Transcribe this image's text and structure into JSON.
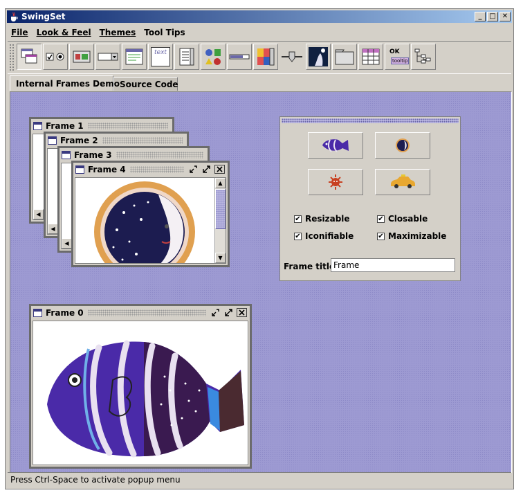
{
  "window": {
    "title": "SwingSet",
    "min_label": "_",
    "max_label": "□",
    "close_label": "✕"
  },
  "menu": [
    {
      "label": "File",
      "mnemonic": "F"
    },
    {
      "label": "Look & Feel",
      "mnemonic": "L"
    },
    {
      "label": "Themes",
      "mnemonic": "T"
    },
    {
      "label": "Tool Tips",
      "mnemonic": "o"
    }
  ],
  "toolbar": {
    "buttons": [
      {
        "name": "internal-frames-icon",
        "selected": true
      },
      {
        "name": "checkbox-radio-icon"
      },
      {
        "name": "button-icon"
      },
      {
        "name": "combobox-icon"
      },
      {
        "name": "filechooser-icon"
      },
      {
        "name": "text-editor-icon",
        "text": "text"
      },
      {
        "name": "list-icon"
      },
      {
        "name": "optionpane-icon"
      },
      {
        "name": "progressbar-icon"
      },
      {
        "name": "scrollpane-icon"
      },
      {
        "name": "slider-icon"
      },
      {
        "name": "splitpane-icon"
      },
      {
        "name": "tabbedpane-icon"
      },
      {
        "name": "table-icon"
      },
      {
        "name": "tooltip-icon",
        "text": "OK",
        "subtext": "tooltip"
      },
      {
        "name": "tree-icon"
      }
    ]
  },
  "tabs": [
    "Internal Frames Demo",
    "Source Code"
  ],
  "frames": [
    {
      "title": "Frame 1"
    },
    {
      "title": "Frame 2"
    },
    {
      "title": "Frame 3"
    },
    {
      "title": "Frame 4"
    },
    {
      "title": "Frame 0"
    }
  ],
  "palette": {
    "checkboxes": [
      {
        "label": "Resizable",
        "checked": true
      },
      {
        "label": "Closable",
        "checked": true
      },
      {
        "label": "Iconifiable",
        "checked": true
      },
      {
        "label": "Maximizable",
        "checked": true
      }
    ],
    "frame_title_label": "Frame title:",
    "frame_title_value": "Frame"
  },
  "status": "Press Ctrl-Space to activate popup menu",
  "colors": {
    "desktop": "#9d9ad2",
    "titlebar_start": "#0a246a",
    "titlebar_end": "#a6caf0"
  }
}
